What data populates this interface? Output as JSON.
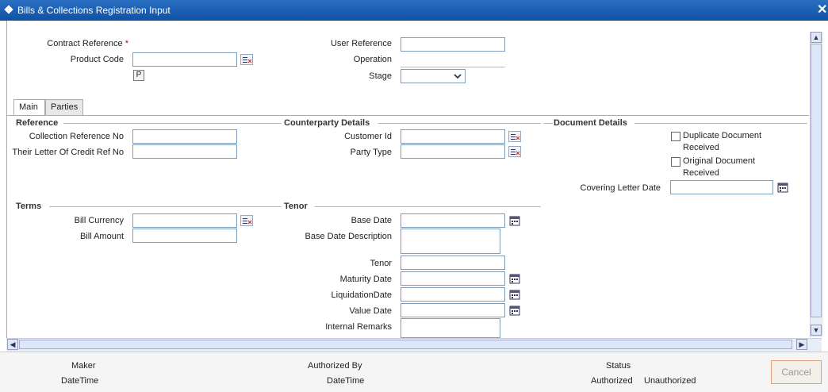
{
  "window": {
    "title": "Bills & Collections Registration Input",
    "close_glyph": "✕"
  },
  "header": {
    "contract_reference_label": "Contract Reference",
    "required_mark": "*",
    "product_code_label": "Product Code",
    "p_button_label": "P",
    "user_reference_label": "User Reference",
    "operation_label": "Operation",
    "stage_label": "Stage"
  },
  "tabs": [
    {
      "label": "Main"
    },
    {
      "label": "Parties"
    }
  ],
  "reference": {
    "title": "Reference",
    "collection_reference_label": "Collection Reference No",
    "their_lc_ref_label": "Their Letter Of Credit Ref No"
  },
  "counterparty": {
    "title": "Counterparty Details",
    "customer_id_label": "Customer Id",
    "party_type_label": "Party Type"
  },
  "document": {
    "title": "Document Details",
    "duplicate_label_1": "Duplicate Document",
    "duplicate_label_2": "Received",
    "original_label_1": "Original Document",
    "original_label_2": "Received",
    "covering_letter_label": "Covering Letter Date"
  },
  "terms": {
    "title": "Terms",
    "bill_currency_label": "Bill Currency",
    "bill_amount_label": "Bill Amount"
  },
  "tenor": {
    "title": "Tenor",
    "base_date_label": "Base Date",
    "base_date_desc_label": "Base Date Description",
    "tenor_label": "Tenor",
    "maturity_date_label": "Maturity Date",
    "liquidation_date_label": "LiquidationDate",
    "value_date_label": "Value Date",
    "internal_remarks_label": "Internal Remarks"
  },
  "footer": {
    "maker_label": "Maker",
    "datetime_label": "DateTime",
    "authorized_by_label": "Authorized By",
    "datetime2_label": "DateTime",
    "status_label": "Status",
    "authorized_label": "Authorized",
    "unauthorized_label": "Unauthorized",
    "cancel_label": "Cancel"
  },
  "colors": {
    "titlebar": "#0f52a5",
    "required": "#cc0000"
  },
  "icons": [
    "list-of-values-icon",
    "calendar-icon",
    "dropdown-arrow-icon",
    "scroll-up-icon",
    "scroll-down-icon",
    "scroll-left-icon",
    "scroll-right-icon"
  ]
}
